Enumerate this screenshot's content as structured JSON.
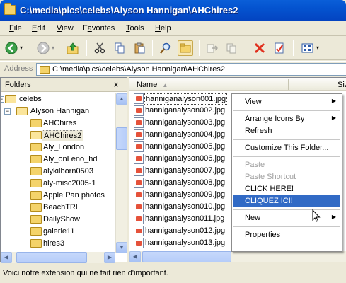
{
  "window": {
    "title": "C:\\media\\pics\\celebs\\Alyson Hannigan\\AHChires2"
  },
  "menubar": {
    "items": [
      {
        "label": "File",
        "key": "F"
      },
      {
        "label": "Edit",
        "key": "E"
      },
      {
        "label": "View",
        "key": "V"
      },
      {
        "label": "Favorites",
        "key": "a"
      },
      {
        "label": "Tools",
        "key": "T"
      },
      {
        "label": "Help",
        "key": "H"
      }
    ]
  },
  "toolbar": {
    "icons": [
      "back-icon",
      "forward-icon",
      "up-folder-icon",
      "cut-icon",
      "copy-icon",
      "paste-icon",
      "search-icon",
      "folders-icon",
      "move-to-icon",
      "copy-to-icon",
      "delete-icon",
      "properties-icon",
      "views-icon"
    ]
  },
  "address": {
    "label": "Address",
    "value": "C:\\media\\pics\\celebs\\Alyson Hannigan\\AHChires2"
  },
  "folders": {
    "title": "Folders",
    "close": "×",
    "tree": [
      {
        "label": "celebs",
        "level": 0,
        "expander": "−",
        "open": true
      },
      {
        "label": "Alyson Hannigan",
        "level": 1,
        "expander": "−",
        "open": true
      },
      {
        "label": "AHChires",
        "level": 2,
        "expander": ""
      },
      {
        "label": "AHChires2",
        "level": 2,
        "expander": "",
        "selected": true,
        "open": true
      },
      {
        "label": "Aly_London",
        "level": 2,
        "expander": ""
      },
      {
        "label": "Aly_onLeno_hd",
        "level": 2,
        "expander": ""
      },
      {
        "label": "alykilborn0503",
        "level": 2,
        "expander": ""
      },
      {
        "label": "aly-misc2005-1",
        "level": 2,
        "expander": ""
      },
      {
        "label": "Apple Pan photos",
        "level": 2,
        "expander": ""
      },
      {
        "label": "BeachTRL",
        "level": 2,
        "expander": ""
      },
      {
        "label": "DailyShow",
        "level": 2,
        "expander": ""
      },
      {
        "label": "galerie11",
        "level": 2,
        "expander": ""
      },
      {
        "label": "hires3",
        "level": 2,
        "expander": ""
      }
    ]
  },
  "files": {
    "columns": [
      {
        "label": "Name",
        "sort": "▲"
      },
      {
        "label": "Siz"
      }
    ],
    "items": [
      "hanniganalyson001.jpg",
      "hanniganalyson002.jpg",
      "hanniganalyson003.jpg",
      "hanniganalyson004.jpg",
      "hanniganalyson005.jpg",
      "hanniganalyson006.jpg",
      "hanniganalyson007.jpg",
      "hanniganalyson008.jpg",
      "hanniganalyson009.jpg",
      "hanniganalyson010.jpg",
      "hanniganalyson011.jpg",
      "hanniganalyson012.jpg",
      "hanniganalyson013.jpg"
    ],
    "focused_index": 0
  },
  "context_menu": {
    "items": [
      {
        "label": "View",
        "underline": "V",
        "submenu": true
      },
      {
        "sep": true
      },
      {
        "label": "Arrange Icons By",
        "underline": "I",
        "submenu": true
      },
      {
        "label": "Refresh",
        "underline": "e"
      },
      {
        "sep": true
      },
      {
        "label": "Customize This Folder..."
      },
      {
        "sep": true
      },
      {
        "label": "Paste",
        "disabled": true
      },
      {
        "label": "Paste Shortcut",
        "disabled": true
      },
      {
        "label": "CLICK HERE!"
      },
      {
        "label": "CLIQUEZ ICI!",
        "highlighted": true
      },
      {
        "sep": true
      },
      {
        "label": "New",
        "underline": "w",
        "submenu": true
      },
      {
        "sep": true
      },
      {
        "label": "Properties",
        "underline": "r"
      }
    ]
  },
  "status": {
    "text": "Voici notre extension qui ne fait rien d'important."
  },
  "colors": {
    "title_bar": "#0453cf",
    "highlight": "#316ac5",
    "face": "#ece9d8"
  }
}
